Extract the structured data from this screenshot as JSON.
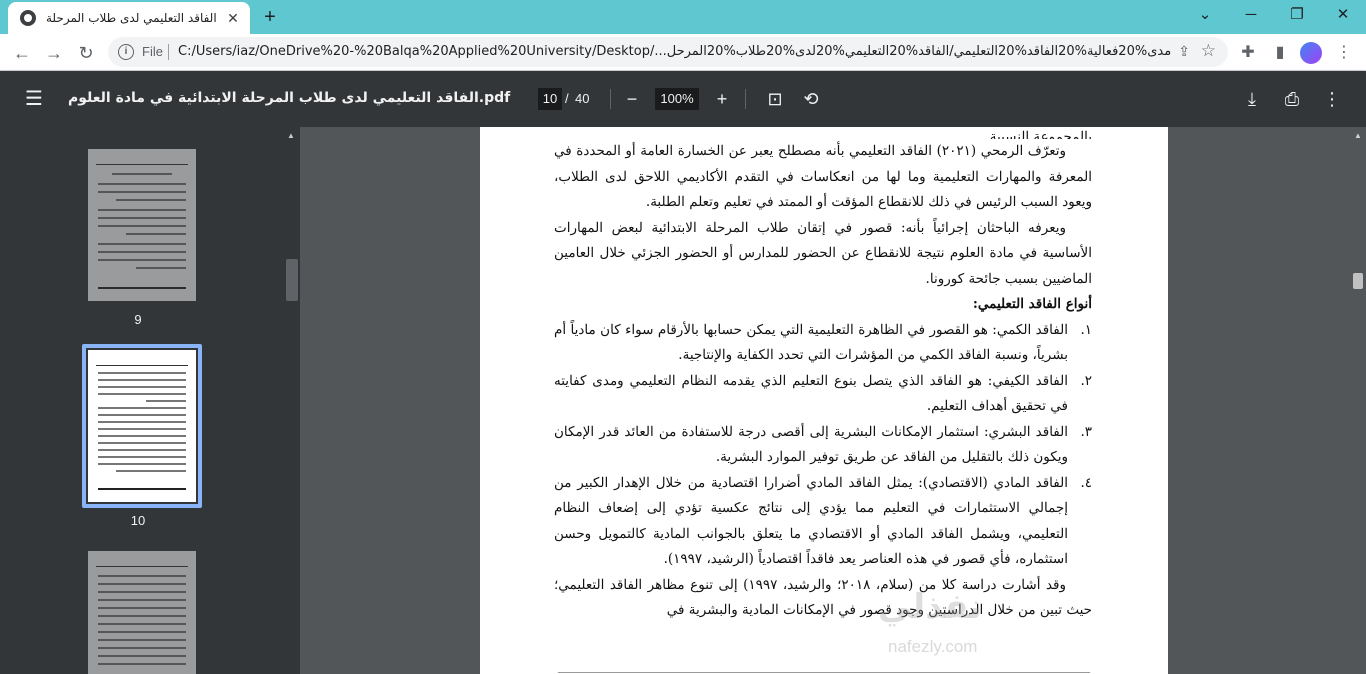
{
  "browser": {
    "tab_title": "الفاقد التعليمي لدى طلاب المرحلة",
    "tab_close": "✕",
    "new_tab": "+",
    "window_minimize": "─",
    "window_restore": "❐",
    "window_close": "✕",
    "tab_search": "⌄",
    "file_label": "File",
    "url": "C:/Users/iaz/OneDrive%20-%20Balqa%20Applied%20University/Desktop/...مدى%20فعالية%20الفاقد%20التعليمي/الفاقد%20التعليمي%20لدى%20طلاب%20المرحل",
    "accent_color": "#5ec7cf"
  },
  "pdf_toolbar": {
    "title": "الفاقد التعليمي لدى طلاب المرحلة الابتدائية في مادة العلوم.pdf",
    "current_page": "10",
    "page_separator": "/",
    "total_pages": "40",
    "zoom": "100%"
  },
  "sidebar": {
    "thumbnails": [
      {
        "label": "9",
        "selected": false
      },
      {
        "label": "10",
        "selected": true
      },
      {
        "label": "",
        "selected": false
      }
    ]
  },
  "document": {
    "top_clipped": "بالمجموعة النسبية...",
    "para1": "وتعرّف الرمحي (٢٠٢١) الفاقد التعليمي بأنه مصطلح يعبر عن الخسارة العامة أو المحددة في المعرفة والمهارات التعليمية وما لها من انعكاسات في التقدم الأكاديمي اللاحق لدى الطلاب، ويعود السبب الرئيس في ذلك للانقطاع المؤقت أو الممتد في تعليم وتعلم الطلبة.",
    "para2": "ويعرفه الباحثان إجرائياً بأنه: قصور في إتقان طلاب المرحلة الابتدائية لبعض المهارات الأساسية في مادة العلوم نتيجة للانقطاع عن الحضور للمدارس أو الحضور الجزئي خلال العامين الماضيين بسبب جائحة كورونا.",
    "heading": "أنواع الفاقد التعليمي:",
    "items": [
      {
        "num": "١.",
        "text": "الفاقد الكمي: هو القصور في الظاهرة التعليمية التي يمكن حسابها بالأرقام سواء كان مادياً أم بشرياً، ونسبة الفاقد الكمي من المؤشرات التي تحدد الكفاية والإنتاجية."
      },
      {
        "num": "٢.",
        "text": "الفاقد الكيفي: هو الفاقد الذي يتصل بنوع التعليم الذي يقدمه النظام التعليمي ومدى كفايته في تحقيق أهداف التعليم."
      },
      {
        "num": "٣.",
        "text": "الفاقد البشري: استثمار الإمكانات البشرية إلى أقصى درجة للاستفادة من العائد قدر الإمكان ويكون ذلك بالتقليل من الفاقد عن طريق توفير الموارد البشرية."
      },
      {
        "num": "٤.",
        "text": "الفاقد المادي (الاقتصادي): يمثل الفاقد المادي أضرارا اقتصادية من خلال الإهدار الكبير من إجمالي الاستثمارات في التعليم مما يؤدي إلى نتائج عكسية تؤدي إلى إضعاف النظام التعليمي، ويشمل الفاقد المادي أو الاقتصادي ما يتعلق بالجوانب المادية كالتمويل وحسن استثماره، فأي قصور في هذه العناصر يعد فاقداً اقتصادياً (الرشيد، ١٩٩٧)."
      }
    ],
    "para3": "وقد أشارت دراسة كلا من (سلام، ٢٠١٨؛ والرشيد، ١٩٩٧) إلى تنوع مظاهر الفاقد التعليمي؛ حيث تبين من خلال الدراستين وجود قصور في الإمكانات المادية والبشرية في",
    "watermark": "نفذلي",
    "watermark_url": "nafezly.com"
  }
}
